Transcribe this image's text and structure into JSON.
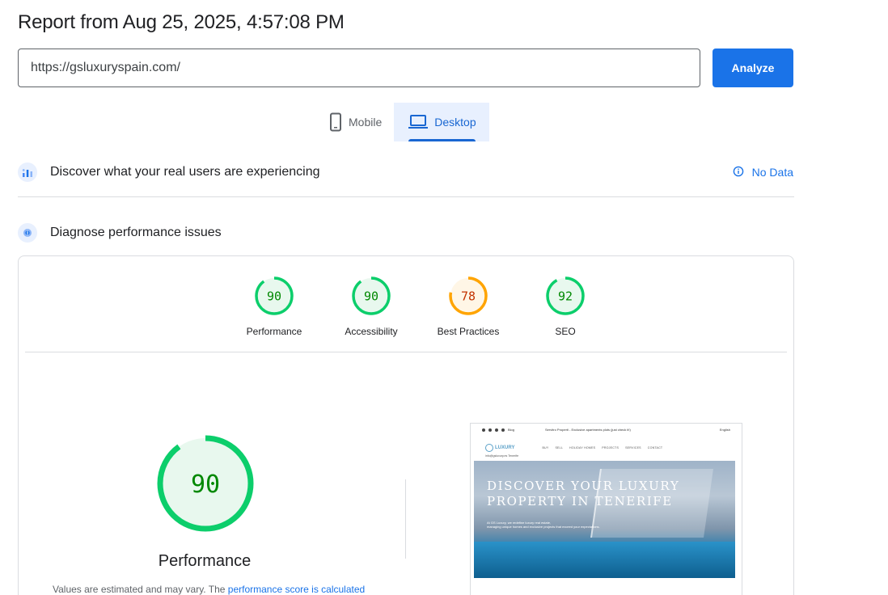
{
  "report": {
    "title": "Report from Aug 25, 2025, 4:57:08 PM"
  },
  "search": {
    "url_value": "https://gsluxuryspain.com/",
    "analyze_label": "Analyze"
  },
  "device_tabs": [
    {
      "label": "Mobile",
      "icon": "smartphone-icon",
      "active": false
    },
    {
      "label": "Desktop",
      "icon": "laptop-icon",
      "active": true
    }
  ],
  "field_data": {
    "title": "Discover what your real users are experiencing",
    "status": "No Data",
    "status_icon": "info-icon"
  },
  "lab_data": {
    "title": "Diagnose performance issues"
  },
  "scores": [
    {
      "label": "Performance",
      "score": "90",
      "color": "#0cce6b",
      "text_color": "#008800",
      "bg": "#e8f8ee"
    },
    {
      "label": "Accessibility",
      "score": "90",
      "color": "#0cce6b",
      "text_color": "#008800",
      "bg": "#e8f8ee"
    },
    {
      "label": "Best Practices",
      "score": "78",
      "color": "#ffa400",
      "text_color": "#c33300",
      "bg": "#fff6e6"
    },
    {
      "label": "SEO",
      "score": "92",
      "color": "#0cce6b",
      "text_color": "#008800",
      "bg": "#e8f8ee"
    }
  ],
  "performance_detail": {
    "score": "90",
    "label": "Performance",
    "note_prefix": "Values are estimated and may vary. The ",
    "note_link": "performance score is calculated"
  },
  "screenshot": {
    "hero_title_line1": "DISCOVER YOUR LUXURY",
    "hero_title_line2": "PROPERTY IN TENERIFE",
    "hero_sub_line1": "At GS Luxury, we redefine luxury real estate,",
    "hero_sub_line2": "managing unique homes and exclusive projects that exceed your expectations.",
    "logo_text": "LUXURY",
    "nav": [
      "BUY",
      "SELL",
      "HOLIDAY HOMES",
      "PROJECTS",
      "SERVICES",
      "CONTACT"
    ],
    "top_left": "Blog",
    "top_center": "Servitro Properti - Exclusive apartments plots (just check it!)",
    "top_right": "English",
    "email": "info@gsluxury.es Tenerife"
  }
}
